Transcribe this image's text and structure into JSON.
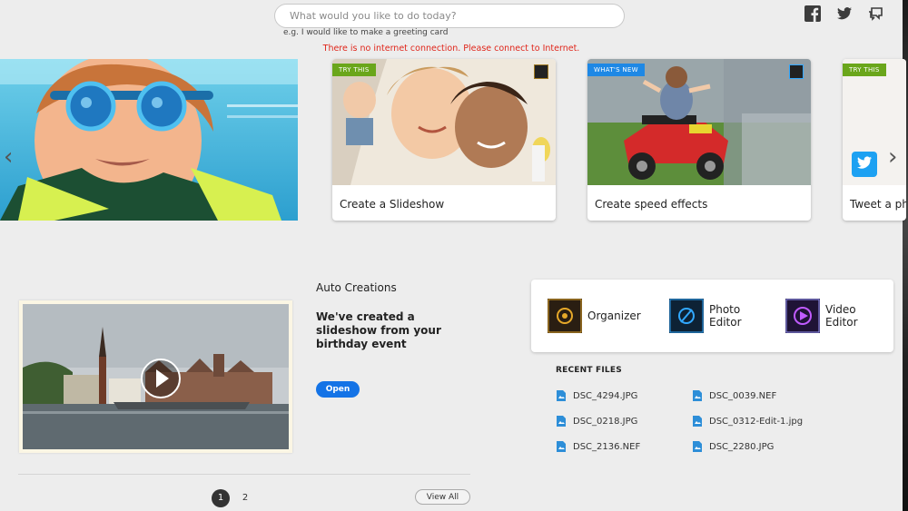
{
  "search": {
    "placeholder": "What would you like to do today?",
    "hint": "e.g. I would like to make a greeting card",
    "error": "There is no internet connection. Please connect to Internet."
  },
  "social": [
    {
      "icon": "facebook-icon"
    },
    {
      "icon": "twitter-icon"
    },
    {
      "icon": "feedback-icon"
    }
  ],
  "carousel": {
    "cards": [
      {
        "badge": "TRY THIS",
        "caption": "Create a Slideshow"
      },
      {
        "badge": "WHAT'S NEW",
        "caption": "Create speed effects"
      },
      {
        "badge": "TRY THIS",
        "caption": "Tweet a ph"
      }
    ],
    "prev_icon": "chevron-left-icon",
    "next_icon": "chevron-right-icon"
  },
  "auto_creations": {
    "title": "Auto Creations",
    "message": "We've created a slideshow from your birthday event",
    "open_label": "Open"
  },
  "pagination": {
    "pages": [
      "1",
      "2"
    ],
    "current": "1",
    "view_all_label": "View All"
  },
  "apps": [
    {
      "name": "Organizer",
      "icon": "organizer-icon",
      "color": "#e6a829"
    },
    {
      "name": "Photo Editor",
      "icon": "photo-editor-icon",
      "color": "#31a8ff"
    },
    {
      "name": "Video Editor",
      "icon": "video-editor-icon",
      "color": "#9999ff"
    }
  ],
  "recent_files": {
    "title": "RECENT FILES",
    "files": [
      "DSC_4294.JPG",
      "DSC_0039.NEF",
      "DSC_0218.JPG",
      "DSC_0312-Edit-1.jpg",
      "DSC_2136.NEF",
      "DSC_2280.JPG"
    ]
  }
}
